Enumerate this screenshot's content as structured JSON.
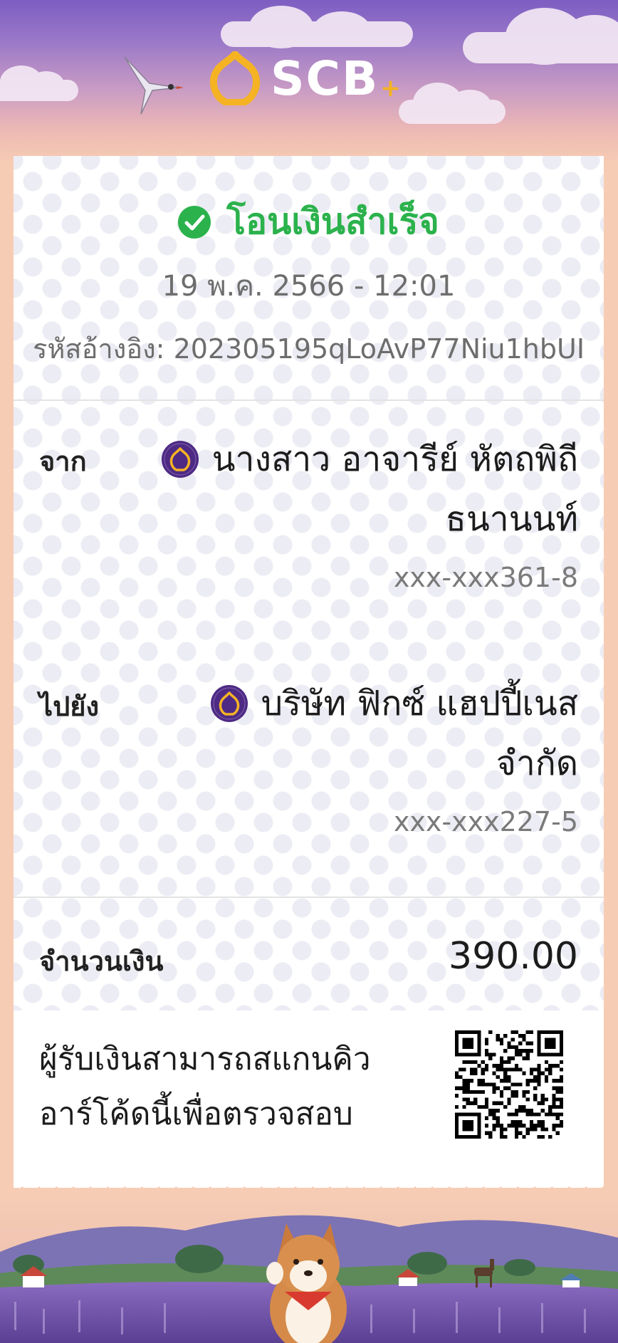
{
  "brand": {
    "name": "SCB",
    "plus": "+",
    "colors": {
      "primary": "#4e2a84",
      "gold": "#f5b324",
      "success": "#2bb24c"
    }
  },
  "receipt": {
    "status": "โอนเงินสำเร็จ",
    "datetime": "19 พ.ค. 2566 - 12:01",
    "reference_label": "รหัสอ้างอิง:",
    "reference_value": "202305195qLoAvP77Niu1hbUI"
  },
  "from": {
    "label": "จาก",
    "name_line1": "นางสาว อาจารีย์ หัตถพิถี",
    "name_line2": "ธนานนท์",
    "account": "xxx-xxx361-8",
    "bank_icon": "scb-bank-icon"
  },
  "to": {
    "label": "ไปยัง",
    "name_line1": "บริษัท ฟิกซ์ แฮปปี้เนส",
    "name_line2": "จำกัด",
    "account": "xxx-xxx227-5",
    "bank_icon": "scb-bank-icon"
  },
  "amount": {
    "label": "จำนวนเงิน",
    "value": "390.00"
  },
  "verify": {
    "line1": "ผู้รับเงินสามารถสแกนคิว",
    "line2": "อาร์โค้ดนี้เพื่อตรวจสอบ",
    "icon": "qr-code"
  }
}
